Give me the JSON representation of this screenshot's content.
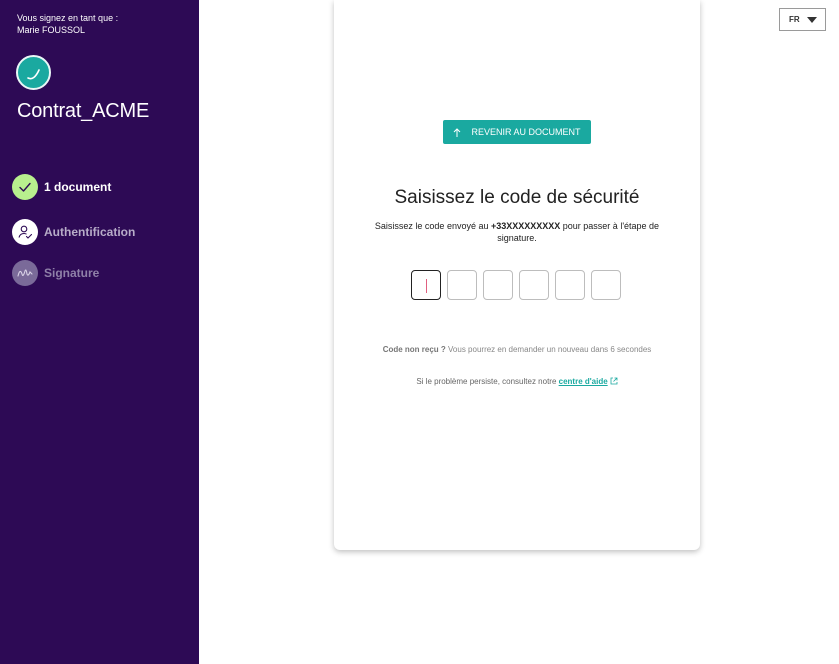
{
  "sidebar": {
    "signer_label": "Vous signez en tant que :",
    "signer_name": "Marie FOUSSOL",
    "document_title": "Contrat_ACME",
    "steps": [
      {
        "label": "1 document",
        "state": "done",
        "icon": "check-icon"
      },
      {
        "label": "Authentification",
        "state": "current",
        "icon": "user-check-icon"
      },
      {
        "label": "Signature",
        "state": "pending",
        "icon": "signature-icon"
      }
    ]
  },
  "language": {
    "selected": "FR"
  },
  "card": {
    "back_label": "REVENIR AU DOCUMENT",
    "heading": "Saisissez le code de sécurité",
    "desc_before": "Saisissez le code envoyé au ",
    "phone": "+33XXXXXXXXX",
    "desc_after": " pour passer à l'étape de signature.",
    "code_digits": [
      "",
      "",
      "",
      "",
      "",
      ""
    ],
    "resend_prefix": "Code non reçu ?",
    "resend_text": " Vous pourrez en demander un nouveau dans 6 secondes",
    "help_prefix": "Si le problème persiste, consultez notre ",
    "help_link": "centre d'aide"
  },
  "colors": {
    "sidebar_bg": "#2d0a55",
    "accent": "#1aa9a0",
    "done_green": "#b8ef8e"
  }
}
